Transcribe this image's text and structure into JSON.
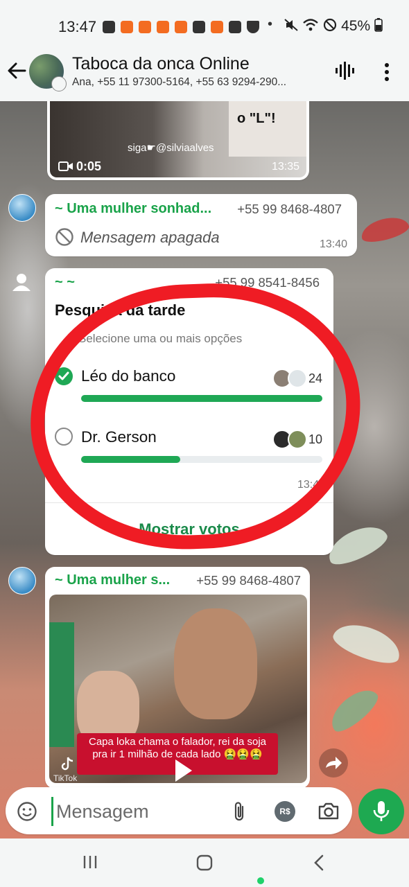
{
  "status_bar": {
    "time": "13:47",
    "battery": "45%"
  },
  "header": {
    "title": "Taboca da onca Online",
    "members": "Ana, +55 11 97300-5164, +55 63 9294-290..."
  },
  "messages": {
    "video1": {
      "duration": "0:05",
      "time": "13:35",
      "watermark": "siga☛@silviaalves",
      "sign_text": "o \"L\"!"
    },
    "deleted": {
      "sender": "~ Uma mulher sonhad...",
      "phone": "+55 99 8468-4807",
      "text": "Mensagem apagada",
      "time": "13:40"
    },
    "poll": {
      "sender": "~ ~",
      "phone": "+55 99 8541-8456",
      "question": "Pesquisa da tarde",
      "hint": "Selecione uma ou mais opções",
      "options": [
        {
          "label": "Léo do banco",
          "votes": "24",
          "selected": true,
          "fraction": 1.0
        },
        {
          "label": "Dr. Gerson",
          "votes": "10",
          "selected": false,
          "fraction": 0.41
        }
      ],
      "time": "13:41",
      "show_votes": "Mostrar votos"
    },
    "video2": {
      "sender": "~ Uma mulher s...",
      "phone": "+55 99 8468-4807",
      "caption": "Capa loka chama o falador, rei da soja pra ir 1 milhão de cada lado 🤮🤮🤮",
      "brand": "TikTok"
    }
  },
  "composer": {
    "placeholder": "Mensagem"
  },
  "colors": {
    "accent": "#1fa855",
    "ring": "#ef1c24",
    "bubble": "#ffffff"
  }
}
